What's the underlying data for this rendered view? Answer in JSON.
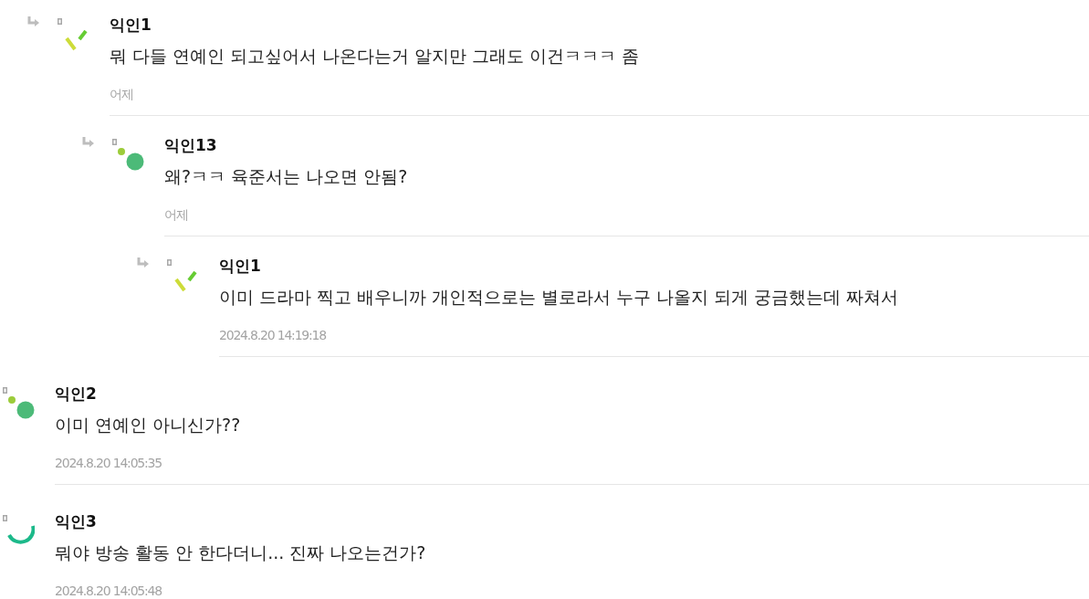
{
  "comments": [
    {
      "author": "익인1",
      "text": "뭐 다들 연예인 되고싶어서 나온다는거 알지만 그래도 이건ㅋㅋㅋ 좀",
      "time": "어제",
      "reply": true,
      "kind": "dashes",
      "children": [
        {
          "author": "익인13",
          "text": "왜?ㅋㅋ 육준서는 나오면 안됨?",
          "time": "어제",
          "reply": true,
          "kind": "dots",
          "children": [
            {
              "author": "익인1",
              "text": "이미 드라마 찍고 배우니까 개인적으로는 별로라서 누구 나올지 되게 궁금했는데 짜쳐서",
              "time": "2024.8.20 14:19:18",
              "reply": true,
              "kind": "dashes"
            }
          ]
        }
      ]
    },
    {
      "author": "익인2",
      "text": "이미 연예인 아니신가??",
      "time": "2024.8.20 14:05:35",
      "reply": false,
      "kind": "dots"
    },
    {
      "author": "익인3",
      "text": "뭐야 방송 활동 안 한다더니... 진짜 나오는건가?",
      "time": "2024.8.20 14:05:48",
      "reply": false,
      "kind": "arc"
    }
  ]
}
